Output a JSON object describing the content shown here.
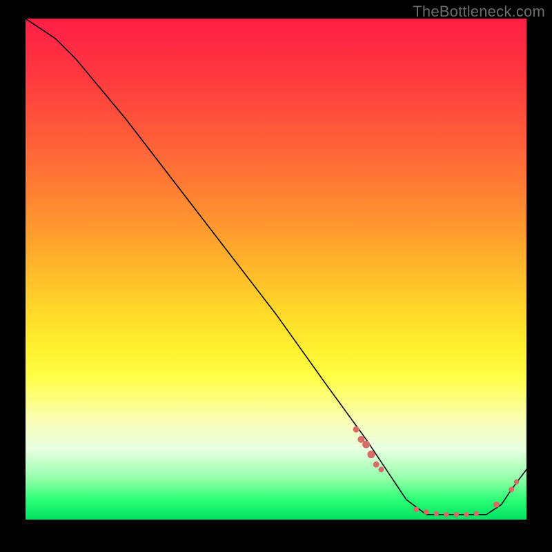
{
  "watermark": "TheBottleneck.com",
  "chart_data": {
    "type": "line",
    "title": "",
    "xlabel": "",
    "ylabel": "",
    "xlim": [
      0,
      100
    ],
    "ylim": [
      0,
      100
    ],
    "grid": false,
    "legend": false,
    "background": "rainbow-vertical",
    "series": [
      {
        "name": "bottleneck-curve",
        "x": [
          0,
          6,
          10,
          20,
          30,
          40,
          50,
          60,
          68,
          72,
          76,
          80,
          84,
          88,
          92,
          95,
          97,
          100
        ],
        "y": [
          100,
          96,
          92,
          80,
          67,
          54,
          41,
          27,
          16,
          10,
          4,
          1,
          1,
          1,
          1,
          3,
          6,
          10
        ]
      }
    ],
    "points": [
      {
        "name": "cluster-left-1",
        "x": 66,
        "y": 18,
        "r": 4.5
      },
      {
        "name": "cluster-left-2",
        "x": 67,
        "y": 16,
        "r": 5.0
      },
      {
        "name": "cluster-left-3",
        "x": 68,
        "y": 15,
        "r": 5.5
      },
      {
        "name": "cluster-left-4",
        "x": 69,
        "y": 13,
        "r": 5.5
      },
      {
        "name": "cluster-left-5",
        "x": 70,
        "y": 11,
        "r": 4.5
      },
      {
        "name": "cluster-left-6",
        "x": 71,
        "y": 10,
        "r": 4.0
      },
      {
        "name": "bottom-1",
        "x": 78,
        "y": 2,
        "r": 3.8
      },
      {
        "name": "bottom-2",
        "x": 80,
        "y": 1.5,
        "r": 3.8
      },
      {
        "name": "bottom-3",
        "x": 82,
        "y": 1.2,
        "r": 3.8
      },
      {
        "name": "bottom-4",
        "x": 84,
        "y": 1.0,
        "r": 3.8
      },
      {
        "name": "bottom-5",
        "x": 86,
        "y": 1.0,
        "r": 3.8
      },
      {
        "name": "bottom-6",
        "x": 88,
        "y": 1.0,
        "r": 3.8
      },
      {
        "name": "bottom-7",
        "x": 90,
        "y": 1.2,
        "r": 3.8
      },
      {
        "name": "right-1",
        "x": 94,
        "y": 3,
        "r": 4.5
      },
      {
        "name": "right-2",
        "x": 97,
        "y": 6,
        "r": 4.0
      },
      {
        "name": "right-3",
        "x": 98,
        "y": 7.5,
        "r": 3.8
      }
    ],
    "colors": {
      "curve": "#000000",
      "points": "#d86b66"
    }
  }
}
